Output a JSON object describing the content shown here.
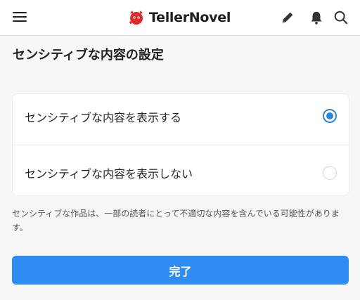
{
  "header": {
    "logo_text": "TellerNovel",
    "brand_color": "#e02b2b",
    "icons": [
      "menu-icon",
      "pencil-icon",
      "bell-icon",
      "search-icon"
    ]
  },
  "page": {
    "title": "センシティブな内容の設定"
  },
  "options": [
    {
      "label": "センシティブな内容を表示する",
      "selected": true
    },
    {
      "label": "センシティブな内容を表示しない",
      "selected": false
    }
  ],
  "note": "センシティブな作品は、一部の読者にとって不適切な内容を含んでいる可能性があります。",
  "actions": {
    "done_label": "完了",
    "button_color": "#2e8cf2"
  }
}
